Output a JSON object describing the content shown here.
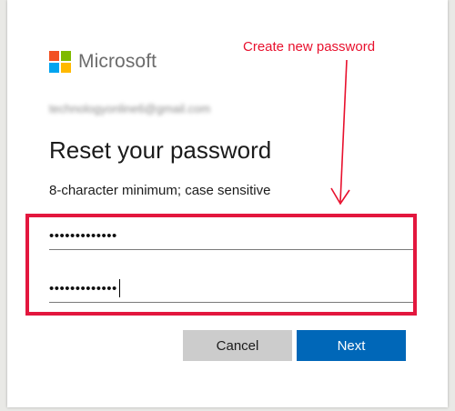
{
  "brand": {
    "name": "Microsoft",
    "logo_colors": [
      "#f25022",
      "#7fba00",
      "#00a4ef",
      "#ffb900"
    ]
  },
  "account": {
    "email": "technologyonline6@gmail.com"
  },
  "heading": {
    "title": "Reset your password",
    "subtitle": "8-character minimum; case sensitive"
  },
  "annotation": {
    "text": "Create new password",
    "color": "#e8102d"
  },
  "form": {
    "new_password_value": "•••••••••••••",
    "confirm_password_value": "•••••••••••••"
  },
  "buttons": {
    "cancel_label": "Cancel",
    "next_label": "Next"
  },
  "colors": {
    "primary": "#0067b8",
    "secondary": "#cccccc",
    "highlight_border": "#e3173e"
  }
}
